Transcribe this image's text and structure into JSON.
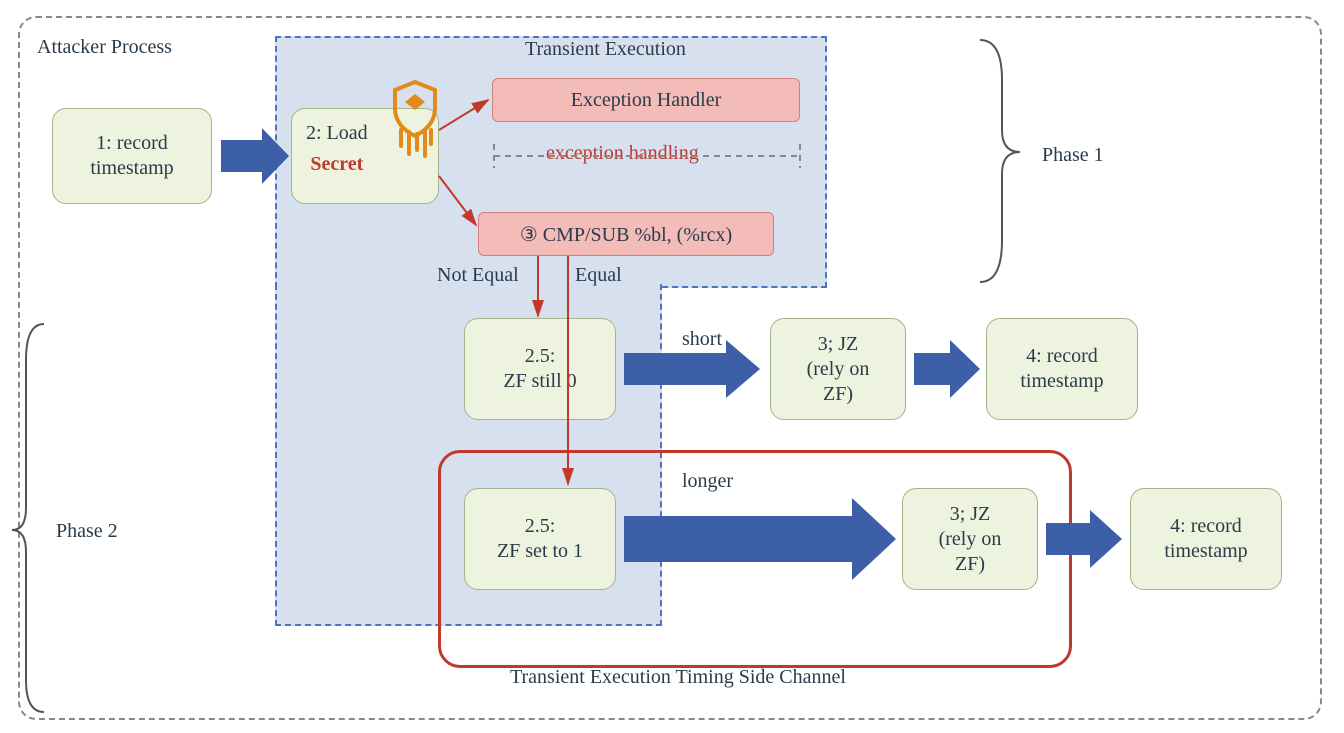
{
  "diagram": {
    "title_attacker": "Attacker Process",
    "title_transient": "Transient Execution",
    "title_side_channel": "Transient Execution Timing Side Channel",
    "phase1": "Phase 1",
    "phase2": "Phase 2",
    "exception_handling": "exception handling",
    "not_equal": "Not Equal",
    "equal": "Equal",
    "short": "short",
    "longer": "longer",
    "box1": "1: record\ntimestamp",
    "box2_load": "2: Load",
    "box2_secret": "Secret",
    "box_exception": "Exception Handler",
    "box_cmp": "③ CMP/SUB %bl, (%rcx)",
    "box25a": "2.5:\nZF still 0",
    "box25b": "2.5:\nZF set to 1",
    "box3a": "3; JZ\n(rely on\nZF)",
    "box3b": "3; JZ\n(rely on\nZF)",
    "box4a": "4: record\ntimestamp",
    "box4b": "4: record\ntimestamp"
  }
}
